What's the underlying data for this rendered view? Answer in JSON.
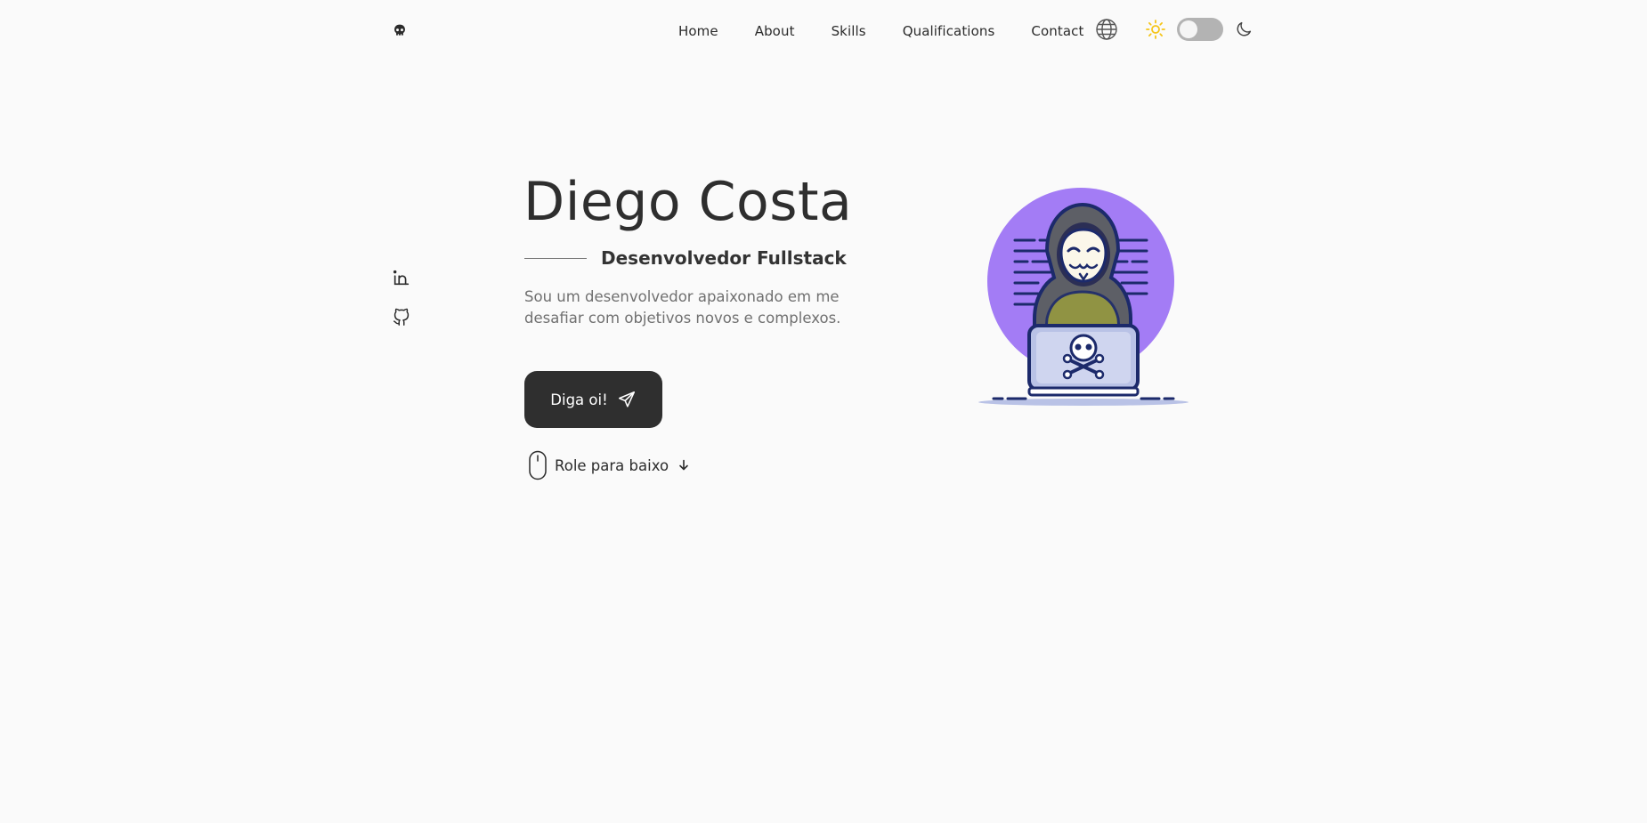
{
  "header": {
    "nav": [
      "Home",
      "About",
      "Skills",
      "Qualifications",
      "Contact"
    ],
    "icons": {
      "logo": "skull-icon",
      "language": "globe-icon",
      "light": "sun-icon",
      "dark": "moon-icon"
    },
    "theme_toggle": {
      "dark_mode_on": false
    }
  },
  "social": [
    {
      "icon": "linkedin-icon"
    },
    {
      "icon": "github-icon"
    }
  ],
  "hero": {
    "title": "Diego Costa",
    "subtitle": "Desenvolvedor Fullstack",
    "description": "Sou um desenvolvedor apaixonado em me desafiar com objetivos novos e complexos.",
    "cta_label": "Diga oi!",
    "scroll_label": "Role para baixo"
  },
  "colors": {
    "background": "#fafafa",
    "text": "#2b2b2b",
    "button": "#2f2f2f",
    "illustration_circle": "#a37cf5",
    "illustration_outline": "#1c2a6b",
    "sun": "#f5c518"
  }
}
